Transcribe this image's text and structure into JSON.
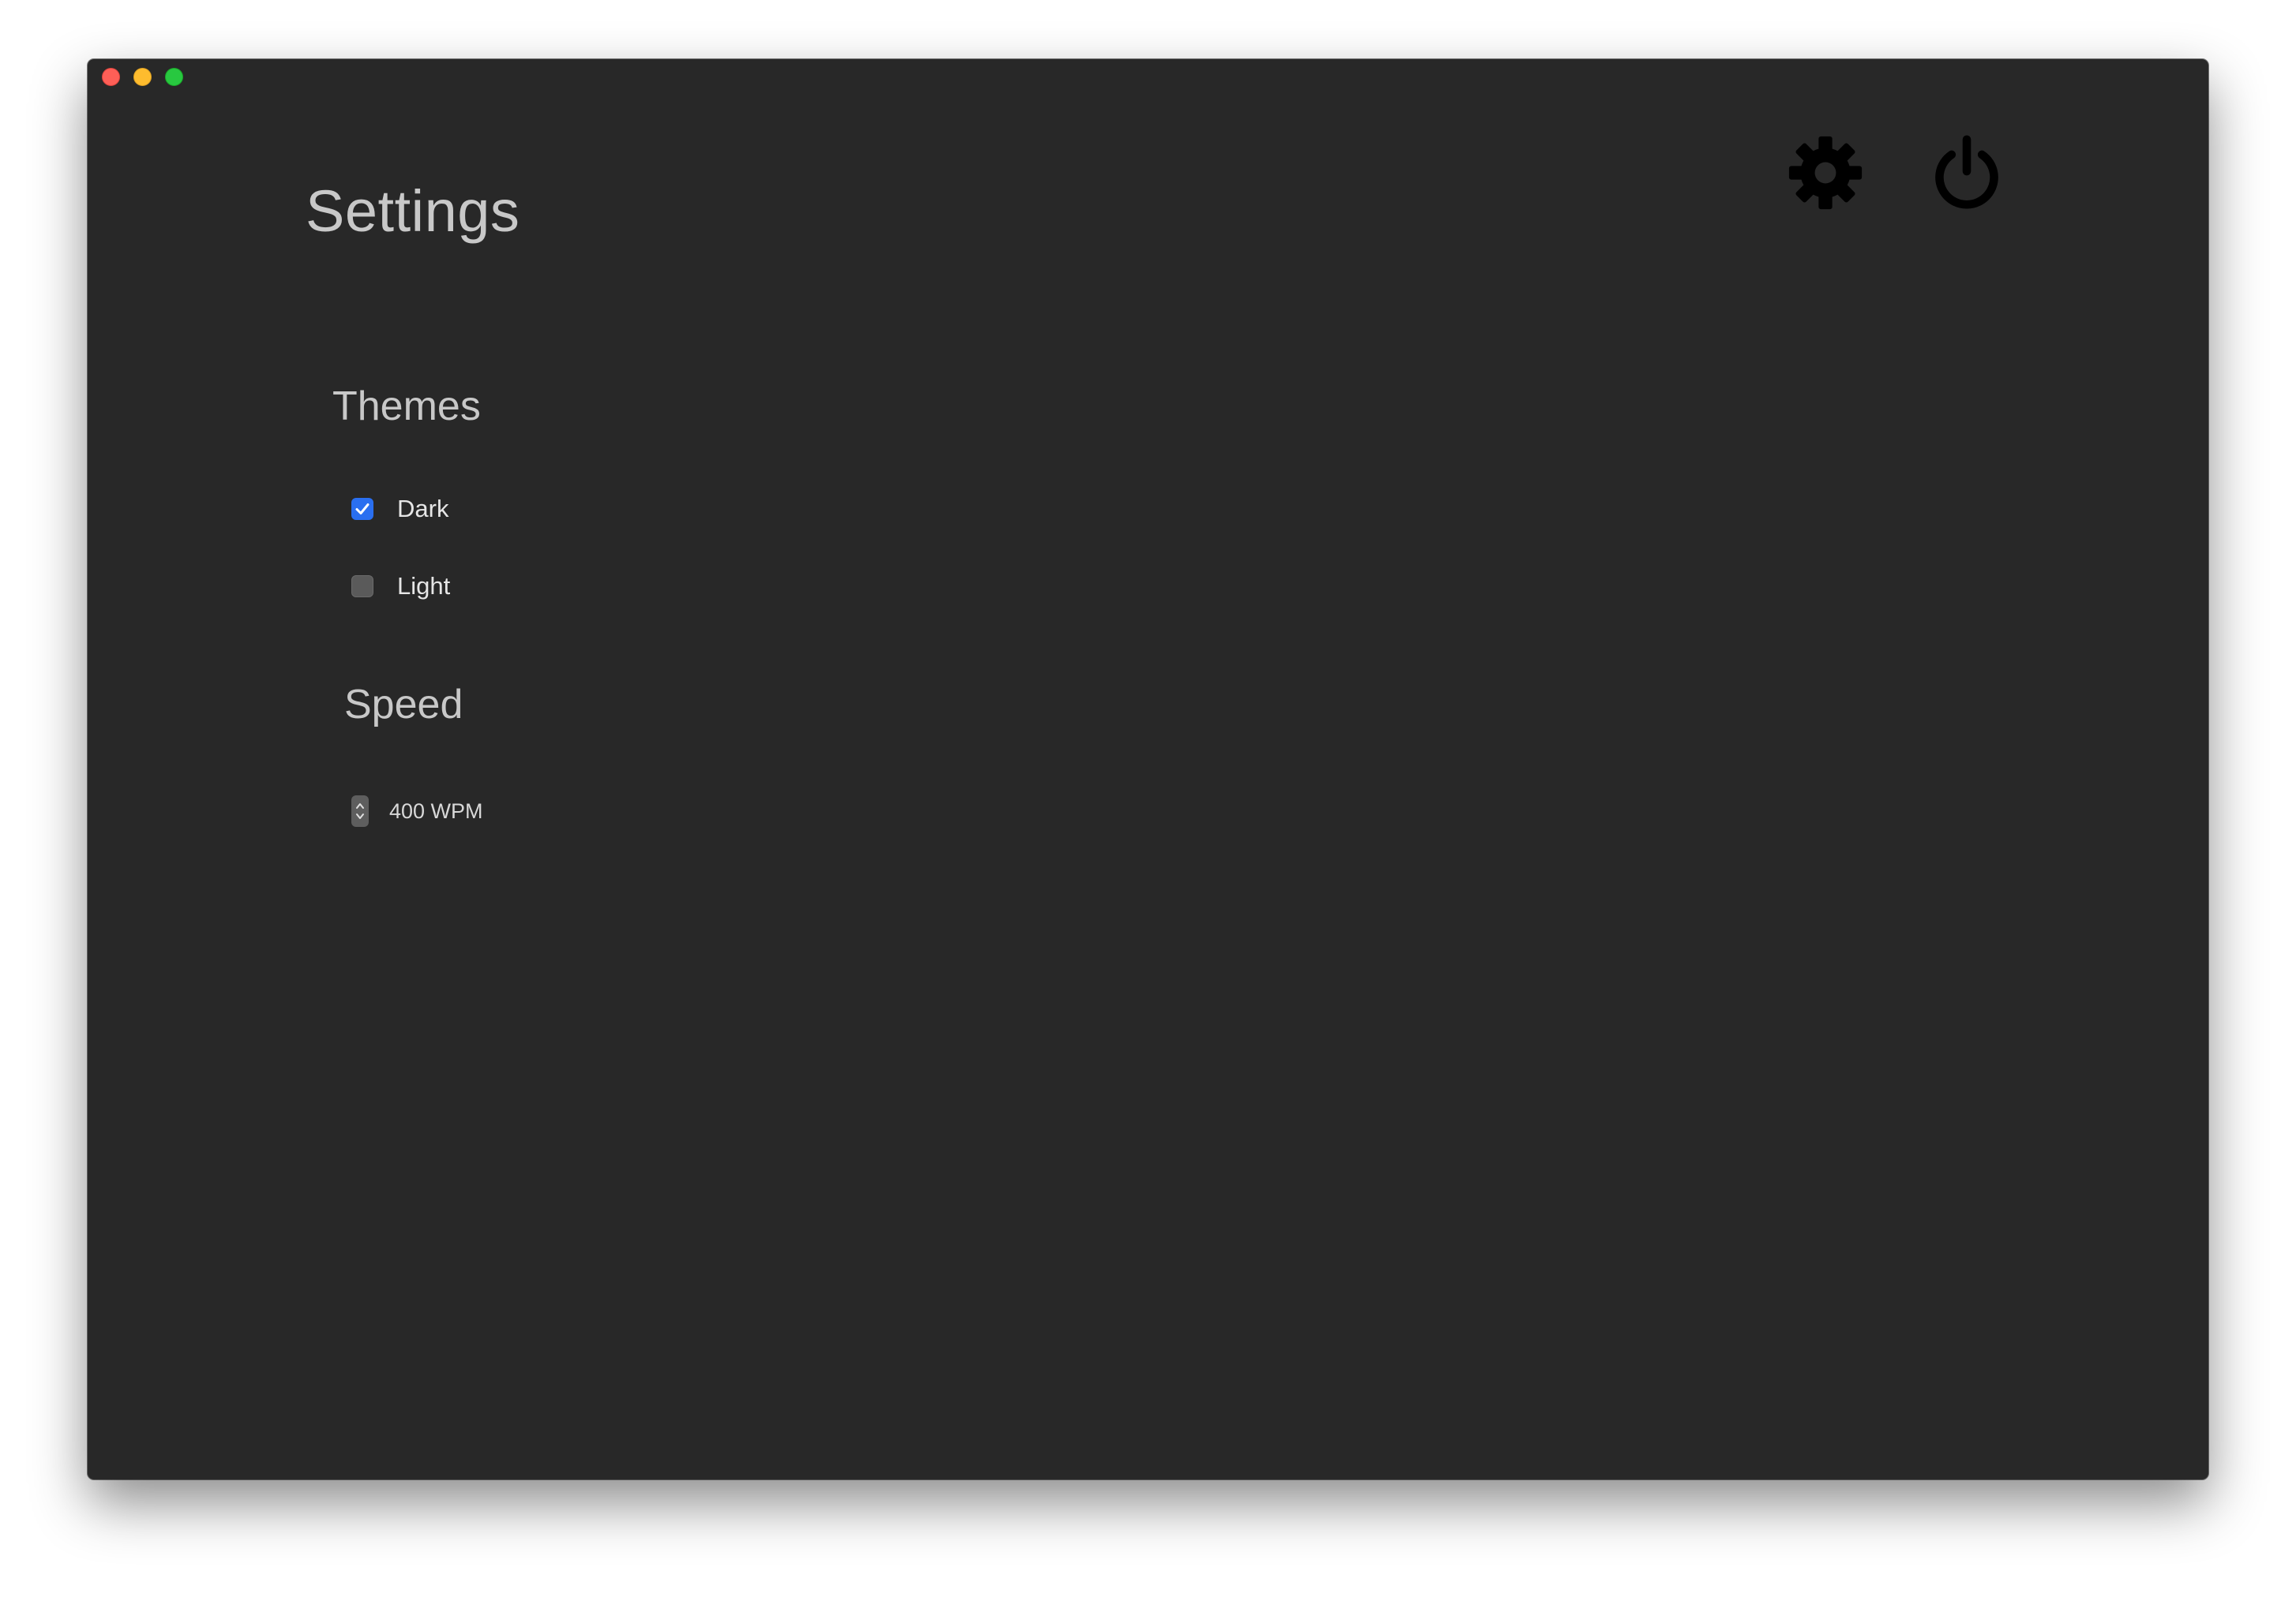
{
  "window": {
    "title": "Settings"
  },
  "header": {
    "gear_icon": "gear-icon",
    "power_icon": "power-icon"
  },
  "themes": {
    "title": "Themes",
    "options": [
      {
        "label": "Dark",
        "checked": true
      },
      {
        "label": "Light",
        "checked": false
      }
    ]
  },
  "speed": {
    "title": "Speed",
    "value": "400 WPM"
  },
  "colors": {
    "background": "#282828",
    "accent": "#2a6ff0",
    "text": "#c8c8c8"
  }
}
